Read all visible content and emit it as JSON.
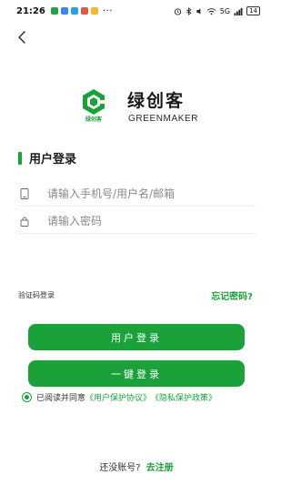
{
  "status_bar": {
    "time": "21:26",
    "app_icon_colors": [
      "#22a446",
      "#3b82f6",
      "#2aa0e0",
      "#e05b3f",
      "#f2b62c"
    ],
    "more": "···",
    "network": "5G",
    "battery": "14"
  },
  "icons": {
    "back": "chevron-left-icon",
    "phone": "phone-icon",
    "lock": "lock-icon"
  },
  "brand": {
    "name_cn": "绿创客",
    "name_en": "GREENMAKER",
    "logo_caption": "绿创客"
  },
  "login": {
    "section_title": "用户登录",
    "account_placeholder": "请输入手机号/用户名/邮箱",
    "password_placeholder": "请输入密码",
    "code_login_label": "验证码登录",
    "forgot_label": "忘记密码?",
    "submit_label": "用户登录",
    "one_click_label": "一键登录"
  },
  "agreement": {
    "prefix": "已阅读并同意",
    "user_protocol": "《用户保护协议》",
    "privacy_policy": "《隐私保护政策》",
    "checked": true
  },
  "register": {
    "prompt": "还没账号?",
    "link": "去注册"
  },
  "colors": {
    "accent": "#1aa13a",
    "text": "#222222",
    "placeholder": "#8a8a8a"
  }
}
